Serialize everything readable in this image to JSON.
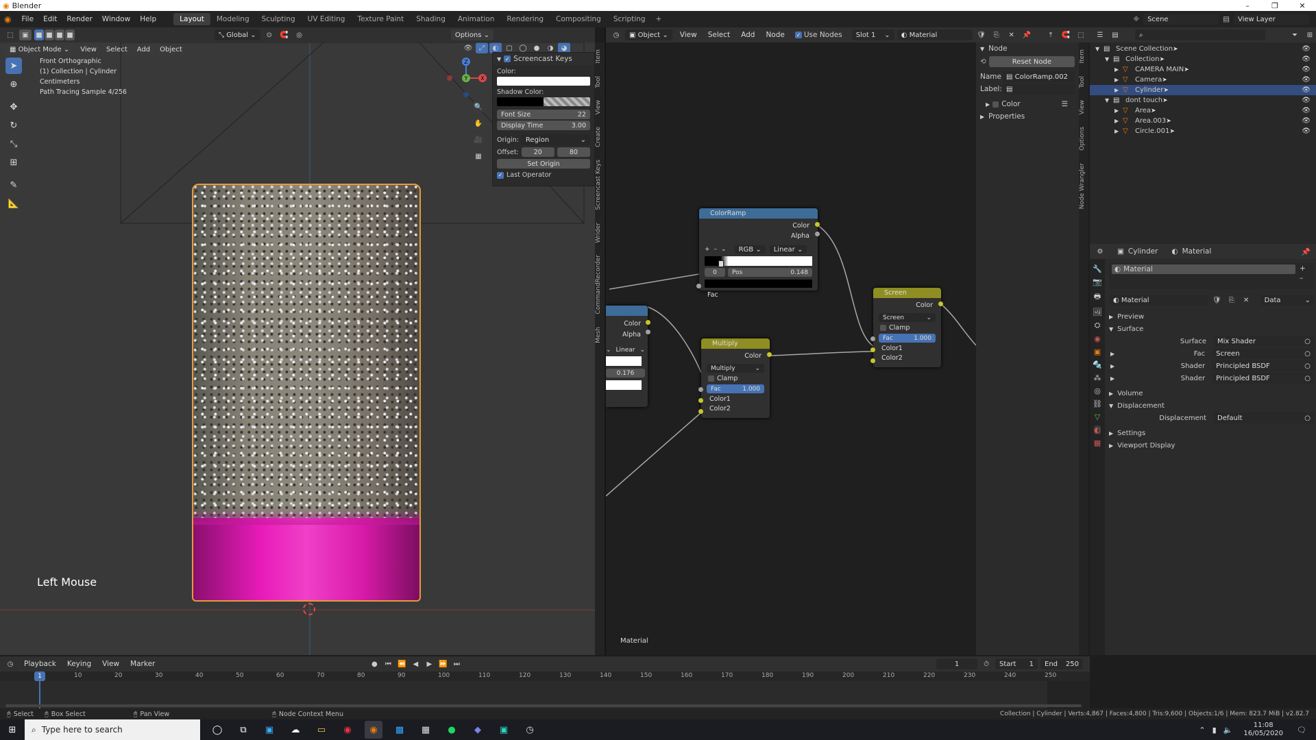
{
  "window": {
    "app_title": "Blender",
    "minimize": "–",
    "maximize": "❐",
    "close": "✕"
  },
  "topbar": {
    "menus": [
      "File",
      "Edit",
      "Render",
      "Window",
      "Help"
    ],
    "workspaces": [
      "Layout",
      "Modeling",
      "Sculpting",
      "UV Editing",
      "Texture Paint",
      "Shading",
      "Animation",
      "Rendering",
      "Compositing",
      "Scripting"
    ],
    "active_workspace": "Layout",
    "add_tab": "+",
    "scene": "Scene",
    "view_layer": "View Layer"
  },
  "viewport": {
    "mode": "Object Mode",
    "menus": [
      "View",
      "Select",
      "Add",
      "Object"
    ],
    "orientation": "Global",
    "options": "Options",
    "info": [
      "Front Orthographic",
      "(1) Collection | Cylinder",
      "Centimeters",
      "Path Tracing Sample 4/256"
    ],
    "screencast_text": "Left Mouse",
    "gizmo": {
      "z": "Z",
      "y": "Y",
      "x": "X"
    }
  },
  "npanel": {
    "title": "Screencast Keys",
    "color_label": "Color:",
    "shadow_color_label": "Shadow Color:",
    "font_size_label": "Font Size",
    "font_size": "22",
    "display_time_label": "Display Time",
    "display_time": "3.00",
    "origin_label": "Origin:",
    "origin": "Region",
    "offset_label": "Offset:",
    "offset_x": "20",
    "offset_y": "80",
    "set_origin": "Set Origin",
    "last_operator": "Last Operator",
    "tabs": [
      "Item",
      "Tool",
      "View",
      "Create",
      "Screencast Keys",
      "Wrider",
      "CommandRecorder",
      "Mesh"
    ]
  },
  "node_editor": {
    "header": {
      "object": "Object",
      "menus": [
        "View",
        "Select",
        "Add",
        "Node"
      ],
      "use_nodes": "Use Nodes",
      "slot": "Slot 1",
      "material": "Material"
    },
    "footer_label": "Material",
    "colorramp": {
      "title": "ColorRamp",
      "out_color": "Color",
      "out_alpha": "Alpha",
      "add": "+",
      "remove": "–",
      "more": "⌄",
      "mode": "RGB",
      "interp": "Linear",
      "stop_index": "0",
      "pos_label": "Pos",
      "pos": "0.148",
      "in_fac": "Fac"
    },
    "partial": {
      "out_color": "Color",
      "out_alpha": "Alpha",
      "interp": "Linear",
      "pos": "0.176"
    },
    "multiply": {
      "title": "Multiply",
      "out_color": "Color",
      "mode": "Multiply",
      "clamp": "Clamp",
      "fac_label": "Fac",
      "fac": "1.000",
      "color1": "Color1",
      "color2": "Color2"
    },
    "screen": {
      "title": "Screen",
      "out_color": "Color",
      "mode": "Screen",
      "clamp": "Clamp",
      "fac_label": "Fac",
      "fac": "1.000",
      "color1": "Color1",
      "color2": "Color2"
    },
    "side_tabs": [
      "Item",
      "Tool",
      "View",
      "Options",
      "Node Wrangler"
    ]
  },
  "node_sidebar": {
    "section": "Node",
    "reset": "Reset Node",
    "name_label": "Name:",
    "name": "ColorRamp.002",
    "label_label": "Label:",
    "color": "Color",
    "properties": "Properties"
  },
  "outliner": {
    "rows": [
      {
        "label": "Scene Collection",
        "indent": 0
      },
      {
        "label": "Collection",
        "indent": 1
      },
      {
        "label": "CAMERA MAIN",
        "indent": 2
      },
      {
        "label": "Camera",
        "indent": 2
      },
      {
        "label": "Cylinder",
        "indent": 2,
        "selected": true
      },
      {
        "label": "dont touch",
        "indent": 1
      },
      {
        "label": "Area",
        "indent": 2
      },
      {
        "label": "Area.003",
        "indent": 2
      },
      {
        "label": "Circle.001",
        "indent": 2
      }
    ]
  },
  "properties": {
    "object": "Cylinder",
    "material_tab": "Material",
    "slot": "Material",
    "material": "Material",
    "data": "Data",
    "sections": {
      "preview": "Preview",
      "surface": "Surface",
      "volume": "Volume",
      "displacement": "Displacement",
      "settings": "Settings",
      "viewport_display": "Viewport Display"
    },
    "surface_label": "Surface",
    "surface": "Mix Shader",
    "fac_label": "Fac",
    "fac": "Screen",
    "shader_label": "Shader",
    "shader1": "Principled BSDF",
    "shader2": "Principled BSDF",
    "displacement_label": "Displacement",
    "displacement": "Default"
  },
  "timeline": {
    "menus": [
      "Playback",
      "Keying",
      "View",
      "Marker"
    ],
    "current": "1",
    "start_label": "Start",
    "start": "1",
    "end_label": "End",
    "end": "250",
    "ticks": [
      "10",
      "20",
      "30",
      "40",
      "50",
      "60",
      "70",
      "80",
      "90",
      "100",
      "110",
      "120",
      "130",
      "140",
      "150",
      "160",
      "170",
      "180",
      "190",
      "200",
      "210",
      "220",
      "230",
      "240",
      "250"
    ],
    "frame": "1"
  },
  "statusbar": {
    "select": "Select",
    "box_select": "Box Select",
    "pan_view": "Pan View",
    "context": "Node Context Menu",
    "stats": "Collection | Cylinder | Verts:4,867 | Faces:4,800 | Tris:9,600 | Objects:1/6 | Mem: 823.7 MiB | v2.82.7"
  },
  "taskbar": {
    "search": "Type here to search",
    "time": "11:08",
    "date": "16/05/2020"
  },
  "colors": {
    "accent": "#4772b3",
    "header_color_node": "#3e6c98",
    "header_mix_node": "#8e8e22",
    "magenta": "#e81bb9",
    "socket_yellow": "#c7c729",
    "selection": "#334d80"
  }
}
